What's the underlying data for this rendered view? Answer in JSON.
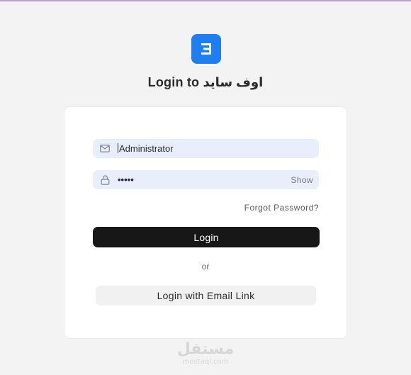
{
  "brand": {
    "logo_icon": "frappe-f-logo-icon",
    "accent_color": "#1f7ff2"
  },
  "header": {
    "title": "Login to اوف سايد"
  },
  "form": {
    "email": {
      "icon": "mail-icon",
      "value": "Administrator"
    },
    "password": {
      "icon": "lock-icon",
      "masked_value": "•••••",
      "show_label": "Show"
    },
    "forgot_label": "Forgot Password?",
    "login_label": "Login",
    "separator": "or",
    "email_link_label": "Login with Email Link"
  },
  "watermark": {
    "main": "مستقل",
    "sub": "mostaql.com"
  }
}
